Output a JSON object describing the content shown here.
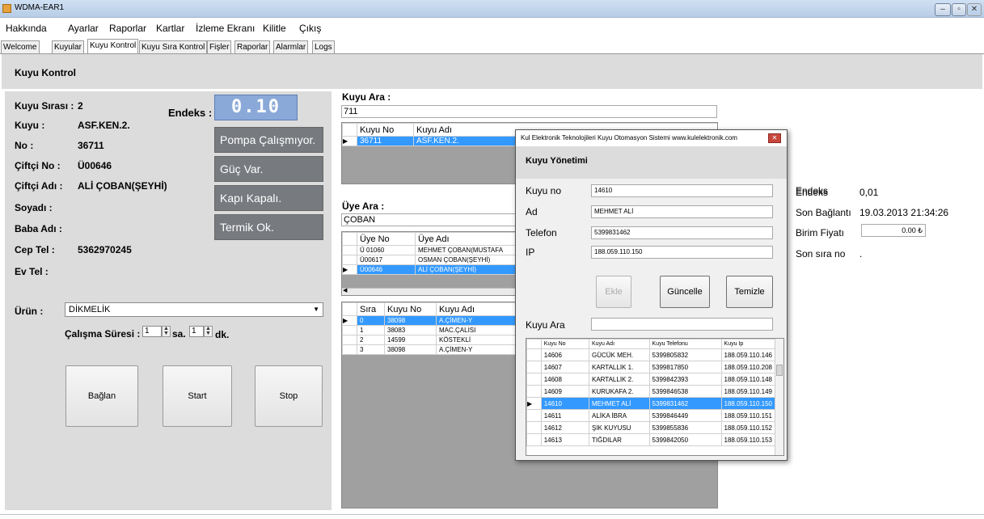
{
  "window": {
    "title": "WDMA-EAR1"
  },
  "menu": [
    "Hakkında",
    "Ayarlar",
    "Raporlar",
    "Kartlar",
    "İzleme Ekranı",
    "Kilitle",
    "Çıkış"
  ],
  "tabs": [
    "Welcome",
    "Kuyular",
    "Kuyu Kontrol",
    "Kuyu Sıra Kontrol",
    "Fişler",
    "Raporlar",
    "Alarmlar",
    "Logs"
  ],
  "active_tab": "Kuyu Kontrol",
  "page_title": "Kuyu Kontrol",
  "left": {
    "kuyu_sirasi_label": "Kuyu Sırası :",
    "kuyu_sirasi_value": "2",
    "endeks_label": "Endeks :",
    "endeks_value": "0.10",
    "kuyu_label": "Kuyu :",
    "kuyu_value": "ASF.KEN.2.",
    "no_label": "No :",
    "no_value": "36711",
    "ciftci_no_label": "Çiftçi No :",
    "ciftci_no_value": "Ü00646",
    "ciftci_adi_label": "Çiftçi Adı :",
    "ciftci_adi_value": "ALİ ÇOBAN(ŞEYHİ)",
    "soyadi_label": "Soyadı   :",
    "baba_adi_label": "Baba Adı :",
    "cep_tel_label": "Cep Tel :",
    "cep_tel_value": "5362970245",
    "ev_tel_label": "Ev Tel :",
    "status_pompa": "Pompa Çalışmıyor.",
    "status_guc": "Güç Var.",
    "status_kapi": "Kapı Kapalı.",
    "status_termik": "Termik Ok.",
    "urun_label": "Ürün :",
    "urun_value": "DİKMELİK",
    "calisma_label": "Çalışma Süresi :",
    "saat_value": "1",
    "saat_unit": "sa.",
    "dakika_value": "1",
    "dakika_unit": "dk.",
    "btn_baglan": "Bağlan",
    "btn_start": "Start",
    "btn_stop": "Stop"
  },
  "middle": {
    "kuyu_ara_label": "Kuyu Ara :",
    "kuyu_ara_value": "711",
    "kuyu_grid": {
      "headers": [
        "Kuyu No",
        "Kuyu Adı"
      ],
      "rows": [
        [
          "36711",
          "ASF.KEN.2."
        ]
      ]
    },
    "uye_ara_label": "Üye Ara :",
    "uye_ara_value": "ÇOBAN",
    "uye_grid": {
      "headers": [
        "Üye No",
        "Üye Adı"
      ],
      "rows": [
        [
          "Ü 01060",
          "MEHMET ÇOBAN(MUSTAFA"
        ],
        [
          "Ü00617",
          "OSMAN ÇOBAN(ŞEYHİ)"
        ],
        [
          "Ü00646",
          "ALİ ÇOBAN(ŞEYHİ)"
        ]
      ]
    },
    "sira_grid": {
      "headers": [
        "Sıra",
        "Kuyu No",
        "Kuyu Adı"
      ],
      "rows": [
        [
          "0",
          "38098",
          "A.ÇİMEN-Y"
        ],
        [
          "1",
          "38083",
          "MAC.ÇALISI"
        ],
        [
          "2",
          "14599",
          "KÖSTEKLİ"
        ],
        [
          "3",
          "38098",
          "A.ÇİMEN-Y"
        ]
      ]
    }
  },
  "dialog": {
    "title": "Kul Elektronik Teknolojileri  Kuyu Otomasyon Sistemi www.kulelektronik.com",
    "header": "Kuyu Yönetimi",
    "kuyu_no_label": "Kuyu no",
    "kuyu_no_value": "14610",
    "ad_label": "Ad",
    "ad_value": "MEHMET ALİ",
    "telefon_label": "Telefon",
    "telefon_value": "5399831462",
    "ip_label": "IP",
    "ip_value": "188.059.110.150",
    "endeks_label": "Endeks",
    "endeks_value": "0,01",
    "son_baglanti_label": "Son Bağlantı",
    "son_baglanti_value": "19.03.2013 21:34:26",
    "birim_fiyati_label": "Birim Fiyatı",
    "birim_fiyati_value": "0.00 ₺",
    "son_sira_label": "Son sıra no",
    "son_sira_value": ".",
    "btn_ekle": "Ekle",
    "btn_guncelle": "Güncelle",
    "btn_temizle": "Temizle",
    "kuyu_ara_label": "Kuyu Ara",
    "grid": {
      "headers": [
        "Kuyu No",
        "Kuyu Adı",
        "Kuyu Telefonu",
        "Kuyu Ip"
      ],
      "rows": [
        [
          "14606",
          "GÜCÜK MEH.",
          "5399805832",
          "188.059.110.146"
        ],
        [
          "14607",
          "KARTALLIK 1.",
          "5399817850",
          "188.059.110.208"
        ],
        [
          "14608",
          "KARTALLIK 2.",
          "5399842393",
          "188.059.110.148"
        ],
        [
          "14609",
          "KURUKAFA 2.",
          "5399846538",
          "188.059.110.149"
        ],
        [
          "14610",
          "MEHMET ALİ",
          "5399831462",
          "188.059.110.150"
        ],
        [
          "14611",
          "ALİKA İBRA",
          "5399846449",
          "188.059.110.151"
        ],
        [
          "14612",
          "ŞIK KUYUSU",
          "5399855836",
          "188.059.110.152"
        ],
        [
          "14613",
          "TIĞDILAR",
          "5399842050",
          "188.059.110.153"
        ]
      ]
    }
  },
  "colors": {
    "selection": "#3399ff",
    "status_box": "#777a7f",
    "endeks_display": "#8aa9d8",
    "panel": "#dcdcdc"
  }
}
